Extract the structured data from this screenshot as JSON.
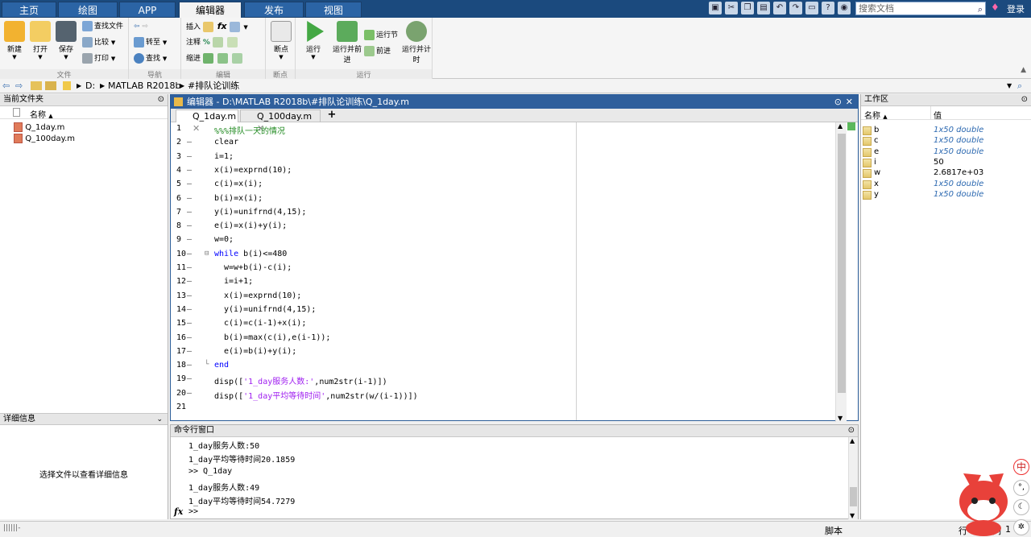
{
  "top_tabs": [
    "主页",
    "绘图",
    "APP",
    "编辑器",
    "发布",
    "视图"
  ],
  "search_doc": {
    "placeholder": "搜索文档"
  },
  "login": "登录",
  "ribbon": {
    "file": {
      "label": "文件",
      "new": "新建",
      "open": "打开",
      "save": "保存",
      "find_files": "查找文件",
      "compare": "比较",
      "print": "打印"
    },
    "nav": {
      "label": "导航",
      "goto": "转至",
      "find": "查找"
    },
    "edit": {
      "label": "编辑",
      "insert": "插入",
      "comment": "注释",
      "indent": "缩进",
      "fx": "fx"
    },
    "breakpoint": {
      "label": "断点",
      "btn": "断点"
    },
    "run": {
      "label": "运行",
      "run": "运行",
      "run_advance": "运行并前进",
      "run_section": "运行节",
      "advance": "前进",
      "run_time": "运行并计时"
    }
  },
  "address": {
    "parts": [
      "D:",
      "MATLAB R2018b",
      "#排队论训练"
    ]
  },
  "current_folder": {
    "title": "当前文件夹",
    "col_name": "名称",
    "files": [
      "Q_1day.m",
      "Q_100day.m"
    ]
  },
  "details": {
    "title": "详细信息",
    "message": "选择文件以查看详细信息"
  },
  "editor": {
    "title": "编辑器 - D:\\MATLAB R2018b\\#排队论训练\\Q_1day.m",
    "tabs": [
      "Q_1day.m",
      "Q_100day.m"
    ],
    "lines": [
      {
        "n": "1",
        "dash": "",
        "code": "%%%排队一天的情况"
      },
      {
        "n": "2",
        "dash": "—",
        "code": "clear"
      },
      {
        "n": "3",
        "dash": "—",
        "code": "i=1;"
      },
      {
        "n": "4",
        "dash": "—",
        "code": "x(i)=exprnd(10);"
      },
      {
        "n": "5",
        "dash": "—",
        "code": "c(i)=x(i);"
      },
      {
        "n": "6",
        "dash": "—",
        "code": "b(i)=x(i);"
      },
      {
        "n": "7",
        "dash": "—",
        "code": "y(i)=unifrnd(4,15);"
      },
      {
        "n": "8",
        "dash": "—",
        "code": "e(i)=x(i)+y(i);"
      },
      {
        "n": "9",
        "dash": "—",
        "code": "w=0;"
      },
      {
        "n": "10",
        "dash": "—",
        "code": "while b(i)<=480"
      },
      {
        "n": "11",
        "dash": "—",
        "code": "w=w+b(i)-c(i);"
      },
      {
        "n": "12",
        "dash": "—",
        "code": "i=i+1;"
      },
      {
        "n": "13",
        "dash": "—",
        "code": "x(i)=exprnd(10);"
      },
      {
        "n": "14",
        "dash": "—",
        "code": "y(i)=unifrnd(4,15);"
      },
      {
        "n": "15",
        "dash": "—",
        "code": "c(i)=c(i-1)+x(i);"
      },
      {
        "n": "16",
        "dash": "—",
        "code": "b(i)=max(c(i),e(i-1));"
      },
      {
        "n": "17",
        "dash": "—",
        "code": "e(i)=b(i)+y(i);"
      },
      {
        "n": "18",
        "dash": "—",
        "code": "end"
      },
      {
        "n": "19",
        "dash": "—",
        "code": "disp(['1_day服务人数:',num2str(i-1)])"
      },
      {
        "n": "20",
        "dash": "—",
        "code": "disp(['1_day平均等待时间',num2str(w/(i-1))])"
      },
      {
        "n": "21",
        "dash": "",
        "code": ""
      }
    ]
  },
  "workspace": {
    "title": "工作区",
    "col_name": "名称",
    "col_value": "值",
    "vars": [
      {
        "name": "b",
        "value": "1x50 double"
      },
      {
        "name": "c",
        "value": "1x50 double"
      },
      {
        "name": "e",
        "value": "1x50 double"
      },
      {
        "name": "i",
        "value": "50"
      },
      {
        "name": "w",
        "value": "2.6817e+03"
      },
      {
        "name": "x",
        "value": "1x50 double"
      },
      {
        "name": "y",
        "value": "1x50 double"
      }
    ]
  },
  "command": {
    "title": "命令行窗口",
    "lines": [
      "1_day服务人数:50",
      "1_day平均等待时间20.1859",
      ">> Q_1day",
      "1_day服务人数:49",
      "1_day平均等待时间54.7279"
    ],
    "prompt": ">>"
  },
  "status": {
    "left": "||||||-",
    "script": "脚本",
    "row": "行",
    "row_val": "1",
    "col": "列",
    "col_val": "1"
  },
  "mascot": {
    "ime": "中"
  }
}
